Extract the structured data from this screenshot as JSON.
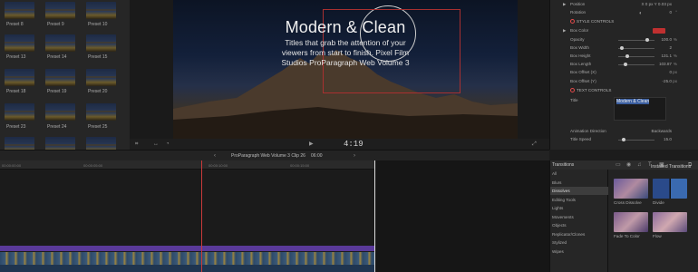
{
  "presets": [
    {
      "label": "Preset 8"
    },
    {
      "label": "Preset 9"
    },
    {
      "label": "Preset 10"
    },
    {
      "label": "Preset 13"
    },
    {
      "label": "Preset 14"
    },
    {
      "label": "Preset 15"
    },
    {
      "label": "Preset 18"
    },
    {
      "label": "Preset 19"
    },
    {
      "label": "Preset 20"
    },
    {
      "label": "Preset 23"
    },
    {
      "label": "Preset 24"
    },
    {
      "label": "Preset 25"
    }
  ],
  "viewer": {
    "title": "Modern & Clean",
    "subtitle_lines": [
      "Titles that grab the attention of your",
      "viewers from start to finish. Pixel Film",
      "Studios ProParagraph Web Volume 3"
    ],
    "timecode": "4:19"
  },
  "inspector": {
    "rows": [
      {
        "label": "Position",
        "value": "X  0 px  Y  0.03 px",
        "unit": ""
      },
      {
        "label": "Rotation",
        "value": "0",
        "unit": "°"
      },
      {
        "label": "Box Color",
        "value": "",
        "unit": ""
      },
      {
        "label": "Opacity",
        "value": "100.0",
        "unit": "%"
      },
      {
        "label": "Box Width",
        "value": "2",
        "unit": ""
      },
      {
        "label": "Box Height",
        "value": "131.1",
        "unit": "%"
      },
      {
        "label": "Box Length",
        "value": "103.87",
        "unit": "%"
      },
      {
        "label": "Box Offset (X)",
        "value": "0",
        "unit": "px"
      },
      {
        "label": "Box Offset (Y)",
        "value": "-25.0",
        "unit": "px"
      },
      {
        "label": "Title",
        "value": "",
        "unit": ""
      },
      {
        "label": "Animation Direction",
        "value": "Backwards",
        "unit": ""
      },
      {
        "label": "Title Speed",
        "value": "15.0",
        "unit": ""
      }
    ],
    "style_controls": "STYLE CONTROLS",
    "text_controls": "TEXT CONTROLS",
    "title_field": "Modern & Clean",
    "box_color_hex": "#c03030"
  },
  "timeline": {
    "clip_title": "ProParagraph Web Volume 3 Clip 26",
    "clip_duration": "06:00",
    "ruler_ticks": [
      "00:00:00:00",
      "00:00:05:00",
      "00:00:10:00",
      "00:00:15:00",
      "00:00:20:00",
      "00:00:25:00"
    ],
    "playhead_color": "#c83a3a",
    "title_bar_color": "#5a3a9a"
  },
  "transitions": {
    "header": "Transitions",
    "installed_header": "Installed Transitions",
    "categories": [
      "All",
      "Blurs",
      "Dissolves",
      "Editing Tools",
      "Lights",
      "Movements",
      "Objects",
      "Replicator/Clones",
      "Stylized",
      "Wipes"
    ],
    "selected_category": "Dissolves",
    "items": [
      {
        "label": "Cross Dissolve"
      },
      {
        "label": "Divide"
      },
      {
        "label": "Fade To Color"
      },
      {
        "label": "Flow"
      }
    ]
  }
}
